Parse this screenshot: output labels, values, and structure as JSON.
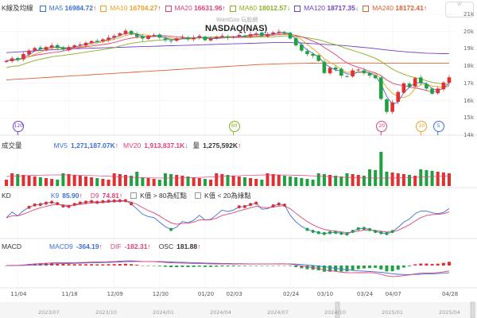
{
  "header": {
    "kline_label": "K線及均線",
    "ma": [
      {
        "name": "MA5",
        "value": "16984.72",
        "arrow": "↑",
        "color": "#3a6fd8"
      },
      {
        "name": "MA10",
        "value": "16704.27",
        "arrow": "↑",
        "color": "#f0a020"
      },
      {
        "name": "MA20",
        "value": "16631.96",
        "arrow": "↑",
        "color": "#e0407a"
      },
      {
        "name": "MA60",
        "value": "18012.57",
        "arrow": "↓",
        "color": "#88b020"
      },
      {
        "name": "MA120",
        "value": "18717.35",
        "arrow": "↓",
        "color": "#7040c8"
      },
      {
        "name": "MA240",
        "value": "18172.41",
        "arrow": "↑",
        "color": "#e06030"
      }
    ],
    "watermark": "WantGoo 玩股網",
    "title": "NASDAQ(NAS)"
  },
  "volume": {
    "label": "成交量",
    "ma5_label": "MV5",
    "ma5_value": "1,271,187.07K",
    "ma5_arrow": "↑",
    "ma20_label": "MV20",
    "ma20_value": "1,913,837.1K",
    "ma20_arrow": "↓",
    "vol_label": "量",
    "vol_value": "1,275,592K",
    "vol_arrow": "↑"
  },
  "kd": {
    "label": "KD",
    "k_label": "K9",
    "k_value": "85.90",
    "k_arrow": "↑",
    "d_label": "D9",
    "d_value": "74.81",
    "d_arrow": "↑",
    "note1": "K值 > 80為紅點",
    "note2": "K值 < 20為綠點"
  },
  "macd": {
    "label": "MACD",
    "macd_label": "MACD9",
    "macd_value": "-364.19",
    "macd_arrow": "↑",
    "dif_label": "DIF",
    "dif_value": "-182.31",
    "dif_arrow": "↑",
    "osc_label": "OSC",
    "osc_value": "181.88",
    "osc_arrow": "↑"
  },
  "markers": [
    {
      "text": "120",
      "color": "#7040c8",
      "index": 2
    },
    {
      "text": "60",
      "color": "#88b020",
      "index": 40
    },
    {
      "text": "20",
      "color": "#e0407a",
      "index": 66
    },
    {
      "text": "10",
      "color": "#f0a020",
      "index": 73
    },
    {
      "text": "5",
      "color": "#3a6fd8",
      "index": 76
    }
  ],
  "nav_labels": [
    "2023/07",
    "2023/10",
    "2024/01",
    "2024/04",
    "2024/07",
    "2024/10",
    "2025/01",
    "2025/04"
  ],
  "chart_data": {
    "type": "candlestick",
    "title": "NASDAQ(NAS)",
    "ylim": [
      14000,
      21000
    ],
    "yticks": [
      "21k",
      "20k",
      "19k",
      "18k",
      "17k",
      "16k",
      "15k",
      "14k"
    ],
    "x_ticks": [
      {
        "label": "11/04",
        "index": 2
      },
      {
        "label": "11/18",
        "index": 11
      },
      {
        "label": "12/09",
        "index": 19
      },
      {
        "label": "12/30",
        "index": 27
      },
      {
        "label": "01/20",
        "index": 35
      },
      {
        "label": "02/03",
        "index": 40
      },
      {
        "label": "02/24",
        "index": 50
      },
      {
        "label": "03/10",
        "index": 56
      },
      {
        "label": "03/24",
        "index": 63
      },
      {
        "label": "04/07",
        "index": 68
      },
      {
        "label": "04/28",
        "index": 78
      }
    ],
    "close": [
      18300,
      18450,
      18350,
      18700,
      18900,
      19050,
      18980,
      19100,
      19200,
      19050,
      18950,
      19100,
      19200,
      19250,
      19350,
      19450,
      19400,
      19550,
      19650,
      19750,
      19900,
      20050,
      19850,
      19700,
      19600,
      19750,
      19800,
      19650,
      19500,
      19450,
      19600,
      19700,
      19550,
      19650,
      19750,
      19500,
      19600,
      19700,
      19750,
      19650,
      19700,
      19800,
      19750,
      19850,
      19900,
      19750,
      19850,
      19950,
      20000,
      19950,
      19600,
      19200,
      18900,
      18700,
      18600,
      18300,
      17600,
      17900,
      17800,
      17450,
      17400,
      17750,
      17800,
      17600,
      17450,
      17300,
      16100,
      15350,
      15900,
      16500,
      17000,
      16800,
      17300,
      17000,
      16700,
      16400,
      16700,
      17050,
      17350
    ],
    "ma120": [
      18780,
      18800,
      18820,
      18840,
      18860,
      18880,
      18900,
      18920,
      18940,
      18960,
      18980,
      19000,
      19010,
      19020,
      19030,
      19040,
      19050,
      19060,
      19070,
      19080,
      19090,
      19100,
      19110,
      19120,
      19130,
      19140,
      19150,
      19160,
      19170,
      19180,
      19190,
      19200,
      19210,
      19220,
      19230,
      19240,
      19250,
      19260,
      19270,
      19280,
      19290,
      19300,
      19310,
      19320,
      19330,
      19340,
      19350,
      19360,
      19370,
      19370,
      19360,
      19350,
      19340,
      19320,
      19300,
      19280,
      19260,
      19240,
      19220,
      19200,
      19170,
      19140,
      19110,
      19080,
      19050,
      19010,
      18970,
      18930,
      18900,
      18870,
      18840,
      18810,
      18790,
      18770,
      18750,
      18740,
      18730,
      18720,
      18717
    ],
    "ma240": [
      17200,
      17220,
      17240,
      17260,
      17280,
      17300,
      17320,
      17340,
      17360,
      17380,
      17400,
      17420,
      17440,
      17460,
      17480,
      17500,
      17520,
      17540,
      17560,
      17580,
      17600,
      17620,
      17640,
      17660,
      17680,
      17700,
      17720,
      17740,
      17760,
      17780,
      17800,
      17820,
      17840,
      17860,
      17880,
      17900,
      17920,
      17940,
      17960,
      17980,
      18000,
      18020,
      18040,
      18060,
      18080,
      18100,
      18110,
      18120,
      18130,
      18140,
      18150,
      18155,
      18160,
      18165,
      18170,
      18172,
      18174,
      18176,
      18178,
      18180,
      18180,
      18179,
      18178,
      18177,
      18176,
      18175,
      18174,
      18174,
      18173,
      18173,
      18172,
      18172,
      18172,
      18172,
      18172,
      18172,
      18172,
      18172,
      18172
    ],
    "volume_note": "bar heights relative",
    "kd_k_red_threshold": 80,
    "kd_k_green_threshold": 20
  }
}
